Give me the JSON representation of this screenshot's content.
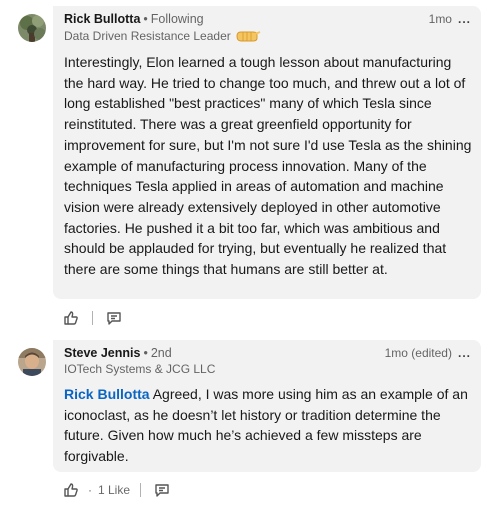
{
  "comments": [
    {
      "author": "Rick Bullotta",
      "separator": "•",
      "connection": "Following",
      "headline": "Data Driven Resistance Leader",
      "timestamp": "1mo",
      "more": "...",
      "body": "Interestingly, Elon learned a tough lesson about manufacturing the hard way.  He tried to change too much, and threw out a lot of long established \"best practices\" many of which Tesla since reinstituted.  There was a great greenfield opportunity for improvement for sure, but I'm not sure I'd use Tesla as the shining example of manufacturing process innovation.  Many of the techniques Tesla applied in areas of automation and machine vision were already extensively deployed in other automotive factories.  He pushed it a bit too far, which was ambitious and should be applauded for trying, but eventually he realized that there are some things that humans are still better at."
    },
    {
      "author": "Steve Jennis",
      "separator": "•",
      "connection": "2nd",
      "headline": "IOTech Systems & JCG LLC",
      "timestamp": "1mo (edited)",
      "more": "...",
      "mention": "Rick Bullotta",
      "body": " Agreed, I was more using him as an example of an iconoclast, as he doesn’t let history or tradition determine the future. Given how much he’s achieved a few missteps are forgivable.",
      "like_count": "1 Like",
      "like_separator": "·"
    }
  ],
  "icons": {
    "like": "thumbs-up-icon",
    "reply": "comment-icon",
    "more": "ellipsis-icon",
    "headline_emoji": "raised-fist-emoji"
  },
  "colors": {
    "bubble": "#f2f2f2",
    "mention": "#0a66c2",
    "secondary_text": "rgba(0,0,0,0.6)"
  }
}
